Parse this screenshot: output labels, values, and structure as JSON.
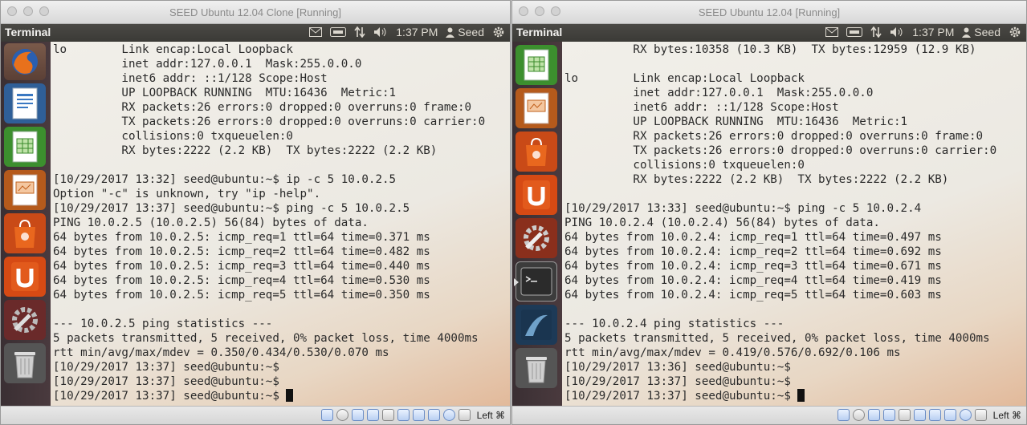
{
  "left_vm": {
    "window_title": "SEED Ubuntu 12.04 Clone [Running]",
    "panel": {
      "app_name": "Terminal",
      "time": "1:37 PM",
      "user": "Seed"
    },
    "launcher": [
      "firefox-icon",
      "libreoffice-writer-icon",
      "libreoffice-calc-icon",
      "libreoffice-impress-icon",
      "ubuntu-software-center-icon",
      "ubuntu-one-icon",
      "system-settings-icon",
      "trash-icon"
    ],
    "terminal_lines": [
      "lo        Link encap:Local Loopback",
      "          inet addr:127.0.0.1  Mask:255.0.0.0",
      "          inet6 addr: ::1/128 Scope:Host",
      "          UP LOOPBACK RUNNING  MTU:16436  Metric:1",
      "          RX packets:26 errors:0 dropped:0 overruns:0 frame:0",
      "          TX packets:26 errors:0 dropped:0 overruns:0 carrier:0",
      "          collisions:0 txqueuelen:0",
      "          RX bytes:2222 (2.2 KB)  TX bytes:2222 (2.2 KB)",
      "",
      "[10/29/2017 13:32] seed@ubuntu:~$ ip -c 5 10.0.2.5",
      "Option \"-c\" is unknown, try \"ip -help\".",
      "[10/29/2017 13:37] seed@ubuntu:~$ ping -c 5 10.0.2.5",
      "PING 10.0.2.5 (10.0.2.5) 56(84) bytes of data.",
      "64 bytes from 10.0.2.5: icmp_req=1 ttl=64 time=0.371 ms",
      "64 bytes from 10.0.2.5: icmp_req=2 ttl=64 time=0.482 ms",
      "64 bytes from 10.0.2.5: icmp_req=3 ttl=64 time=0.440 ms",
      "64 bytes from 10.0.2.5: icmp_req=4 ttl=64 time=0.530 ms",
      "64 bytes from 10.0.2.5: icmp_req=5 ttl=64 time=0.350 ms",
      "",
      "--- 10.0.2.5 ping statistics ---",
      "5 packets transmitted, 5 received, 0% packet loss, time 4000ms",
      "rtt min/avg/max/mdev = 0.350/0.434/0.530/0.070 ms",
      "[10/29/2017 13:37] seed@ubuntu:~$",
      "[10/29/2017 13:37] seed@ubuntu:~$",
      "[10/29/2017 13:37] seed@ubuntu:~$ "
    ],
    "statusbar": {
      "host_key": "Left ⌘"
    }
  },
  "right_vm": {
    "window_title": "SEED Ubuntu 12.04 [Running]",
    "panel": {
      "app_name": "Terminal",
      "time": "1:37 PM",
      "user": "Seed"
    },
    "launcher": [
      "libreoffice-calc-icon",
      "libreoffice-impress-icon",
      "ubuntu-software-center-icon",
      "ubuntu-one-icon",
      "system-settings-icon",
      "terminal-icon",
      "wireshark-icon",
      "trash-icon"
    ],
    "terminal_lines": [
      "          RX bytes:10358 (10.3 KB)  TX bytes:12959 (12.9 KB)",
      "",
      "lo        Link encap:Local Loopback",
      "          inet addr:127.0.0.1  Mask:255.0.0.0",
      "          inet6 addr: ::1/128 Scope:Host",
      "          UP LOOPBACK RUNNING  MTU:16436  Metric:1",
      "          RX packets:26 errors:0 dropped:0 overruns:0 frame:0",
      "          TX packets:26 errors:0 dropped:0 overruns:0 carrier:0",
      "          collisions:0 txqueuelen:0",
      "          RX bytes:2222 (2.2 KB)  TX bytes:2222 (2.2 KB)",
      "",
      "[10/29/2017 13:33] seed@ubuntu:~$ ping -c 5 10.0.2.4",
      "PING 10.0.2.4 (10.0.2.4) 56(84) bytes of data.",
      "64 bytes from 10.0.2.4: icmp_req=1 ttl=64 time=0.497 ms",
      "64 bytes from 10.0.2.4: icmp_req=2 ttl=64 time=0.692 ms",
      "64 bytes from 10.0.2.4: icmp_req=3 ttl=64 time=0.671 ms",
      "64 bytes from 10.0.2.4: icmp_req=4 ttl=64 time=0.419 ms",
      "64 bytes from 10.0.2.4: icmp_req=5 ttl=64 time=0.603 ms",
      "",
      "--- 10.0.2.4 ping statistics ---",
      "5 packets transmitted, 5 received, 0% packet loss, time 4000ms",
      "rtt min/avg/max/mdev = 0.419/0.576/0.692/0.106 ms",
      "[10/29/2017 13:36] seed@ubuntu:~$",
      "[10/29/2017 13:37] seed@ubuntu:~$",
      "[10/29/2017 13:37] seed@ubuntu:~$ "
    ],
    "statusbar": {
      "host_key": "Left ⌘"
    }
  }
}
